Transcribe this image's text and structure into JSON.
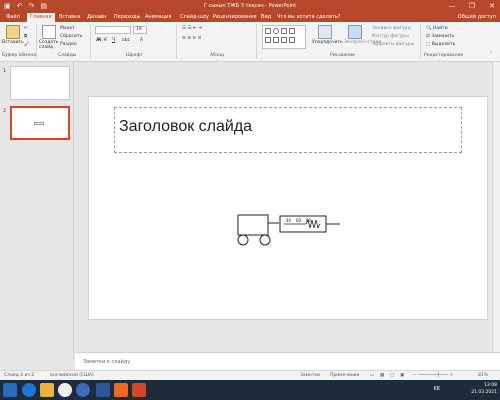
{
  "window": {
    "title": "Г сынып ТЖБ 3 тоқсан - PowerPoint",
    "minimize": "—",
    "restore": "❐",
    "close": "✕"
  },
  "tabs": [
    {
      "label": "Файл"
    },
    {
      "label": "Главная",
      "active": true
    },
    {
      "label": "Вставка"
    },
    {
      "label": "Дизайн"
    },
    {
      "label": "Переходы"
    },
    {
      "label": "Анимация"
    },
    {
      "label": "Слайд-шоу"
    },
    {
      "label": "Рецензирование"
    },
    {
      "label": "Вид"
    },
    {
      "label": "Что вы хотите сделать?"
    }
  ],
  "share_label": "Общий доступ",
  "ribbon": {
    "clipboard": {
      "paste": "Вставить",
      "label": "Буфер обмена"
    },
    "slides": {
      "new_slide": "Создать слайд",
      "layout": "Макет",
      "reset": "Сбросить",
      "section": "Раздел",
      "label": "Слайды"
    },
    "font": {
      "label": "Шрифт",
      "size": "18"
    },
    "paragraph": {
      "label": "Абзац"
    },
    "drawing": {
      "arrange": "Упорядочить",
      "quick_styles": "Экспресс-стили",
      "shape_fill": "Заливка фигуры",
      "shape_outline": "Контур фигуры",
      "shape_effects": "Эффекты фигуры",
      "label": "Рисование"
    },
    "editing": {
      "find": "Найти",
      "replace": "Заменить",
      "select": "Выделить",
      "label": "Редактирование"
    }
  },
  "thumbnails": [
    {
      "num": "1"
    },
    {
      "num": "2"
    }
  ],
  "slide": {
    "title": "Заголовок слайда",
    "scale_labels": [
      "40",
      "60",
      "80"
    ]
  },
  "notes_placeholder": "Заметки к слайду",
  "status": {
    "slide_count": "Слайд 2 из 2",
    "language": "английский (США)",
    "notes": "Заметки",
    "comments": "Примечания",
    "zoom": "81%"
  },
  "taskbar": {
    "lang": "KK",
    "time": "13:08",
    "date": "21.03.2021"
  }
}
